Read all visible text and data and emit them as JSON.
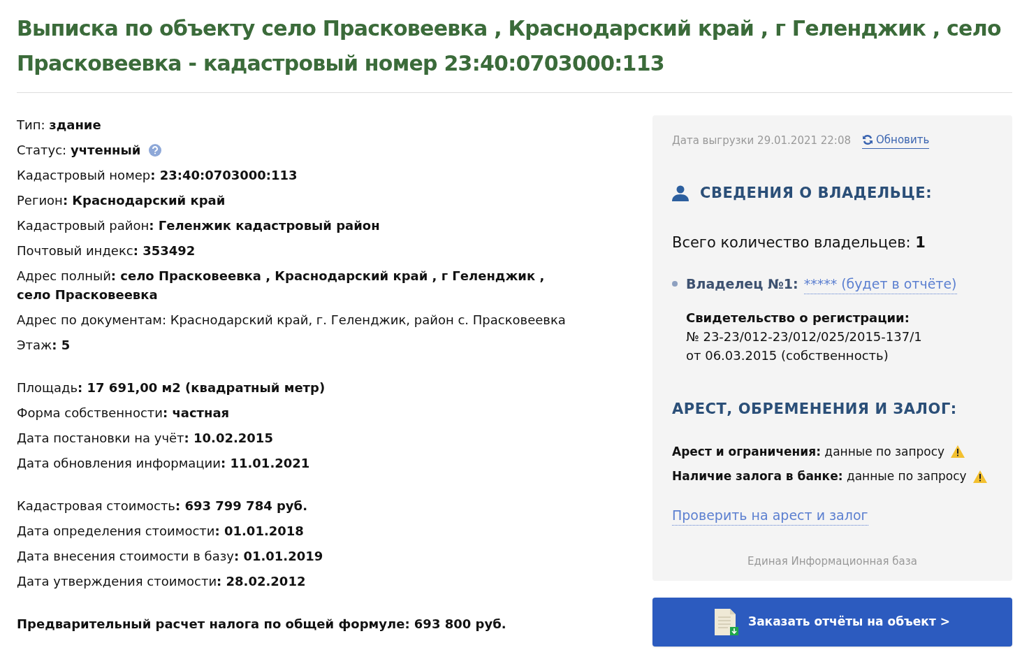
{
  "title": "Выписка по объекту село Прасковеевка , Краснодарский край , г Геленджик , село Прасковеевка - кадастровый номер 23:40:0703000:113",
  "field_groups": [
    [
      {
        "text": "Тип: **здание**"
      },
      {
        "text": "Статус: **учтенный**",
        "help": true
      },
      {
        "text": "Кадастровый номер**: 23:40:0703000:113**"
      },
      {
        "text": "Регион**: Краснодарский край**"
      },
      {
        "text": "Кадастровый район**: Геленжик кадастровый район**"
      },
      {
        "text": "Почтовый индекс**: 353492**"
      },
      {
        "text": "Адрес полный**: село Прасковеевка , Краснодарский край , г Геленджик , село Прасковеевка**"
      },
      {
        "text": "Адрес по документам: Краснодарский край, г. Геленджик, район с. Прасковеевка"
      },
      {
        "text": "Этаж**: 5**"
      }
    ],
    [
      {
        "text": "Площадь**: 17 691,00 м2 (квадратный метр)**"
      },
      {
        "text": "Форма собственности**: частная**"
      },
      {
        "text": "Дата постановки на учёт**: 10.02.2015**"
      },
      {
        "text": "Дата обновления информации**: 11.01.2021**"
      }
    ],
    [
      {
        "text": "Кадастровая стоимость**: 693 799 784 руб.**"
      },
      {
        "text": "Дата определения стоимости**: 01.01.2018**"
      },
      {
        "text": "Дата внесения стоимости в базу**: 01.01.2019**"
      },
      {
        "text": "Дата утверждения стоимости**: 28.02.2012**"
      }
    ]
  ],
  "tax_note": "Предварительный расчет налога по общей формуле: 693 800 руб.",
  "panel": {
    "export_date": "Дата выгрузки 29.01.2021 22:08",
    "refresh_link": "Обновить",
    "owner_heading": "СВЕДЕНИЯ О ВЛАДЕЛЬЦЕ:",
    "owner_count": "Всего количество владельцев: **1**",
    "owners": [
      {
        "label": "Владелец №1:",
        "value": "***** (будет в отчёте)",
        "certificate_title": "Свидетельство о регистрации:",
        "certificate_number": "№ 23-23/012-23/012/025/2015-137/1",
        "certificate_date": "от 06.03.2015 (собственность)"
      }
    ],
    "encumbrance_heading": "АРЕСТ, ОБРЕМЕНЕНИЯ И ЗАЛОГ:",
    "encumbrances": [
      {
        "text": "**Арест и ограничения:** данные по запросу",
        "warning": true
      },
      {
        "text": "**Наличие залога в банке:** данные по запросу",
        "warning": true
      }
    ],
    "check_link": "Проверить на арест и залог",
    "footer": "Единая Информационная база"
  },
  "order_button": "Заказать отчёты на объект >"
}
